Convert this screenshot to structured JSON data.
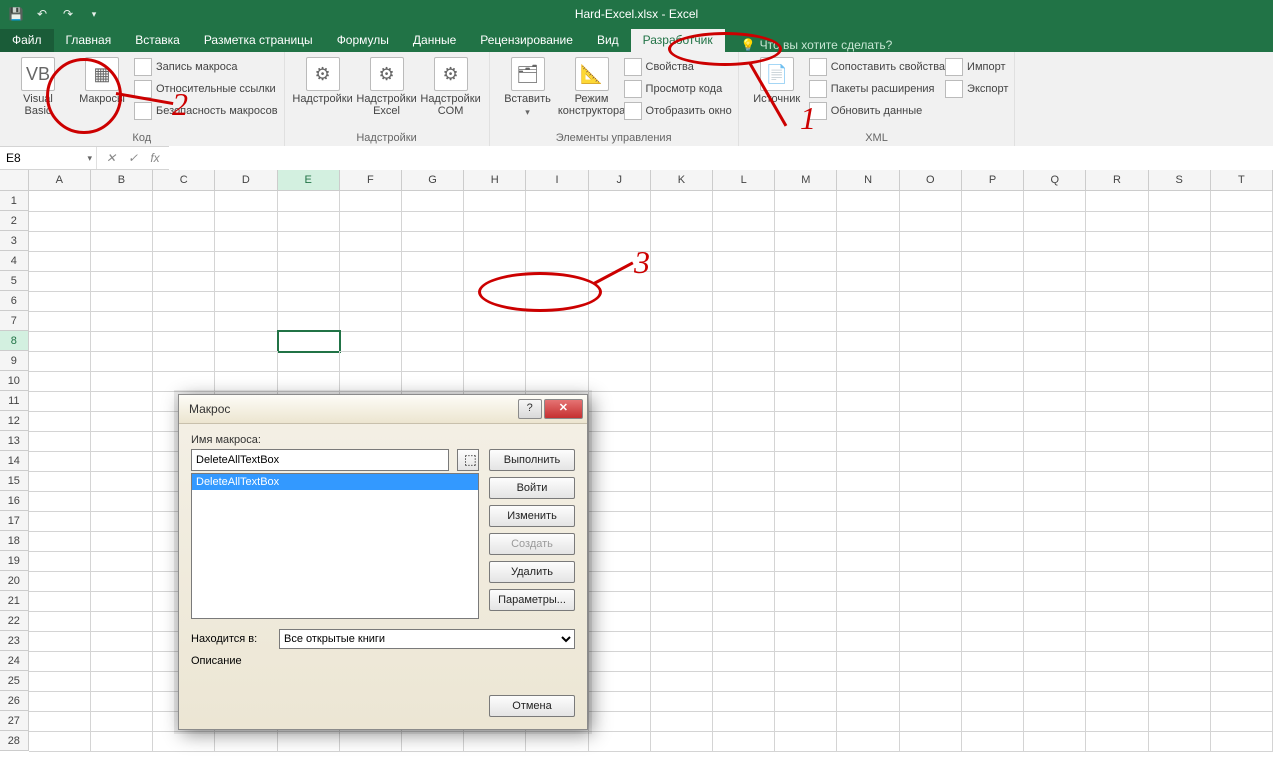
{
  "title": "Hard-Excel.xlsx - Excel",
  "tabs": {
    "file": "Файл",
    "home": "Главная",
    "insert": "Вставка",
    "layout": "Разметка страницы",
    "formulas": "Формулы",
    "data": "Данные",
    "review": "Рецензирование",
    "view": "Вид",
    "developer": "Разработчик",
    "tellme": "Что вы хотите сделать?"
  },
  "ribbon": {
    "code": {
      "vb": "Visual\nBasic",
      "macros": "Макросы",
      "record": "Запись макроса",
      "relative": "Относительные ссылки",
      "security": "Безопасность макросов",
      "group": "Код"
    },
    "addins": {
      "addins": "Надстройки",
      "excel": "Надстройки\nExcel",
      "com": "Надстройки\nCOM",
      "group": "Надстройки"
    },
    "controls": {
      "insert": "Вставить",
      "design": "Режим\nконструктора",
      "props": "Свойства",
      "viewcode": "Просмотр кода",
      "showwin": "Отобразить окно",
      "group": "Элементы управления"
    },
    "xml": {
      "source": "Источник",
      "mapprops": "Сопоставить свойства",
      "expansion": "Пакеты расширения",
      "refresh": "Обновить данные",
      "import": "Импорт",
      "export": "Экспорт",
      "group": "XML"
    }
  },
  "namebox": "E8",
  "columns": [
    "A",
    "B",
    "C",
    "D",
    "E",
    "F",
    "G",
    "H",
    "I",
    "J",
    "K",
    "L",
    "M",
    "N",
    "O",
    "P",
    "Q",
    "R",
    "S",
    "T"
  ],
  "rows": [
    "1",
    "2",
    "3",
    "4",
    "5",
    "6",
    "7",
    "8",
    "9",
    "10",
    "11",
    "12",
    "13",
    "14",
    "15",
    "16",
    "17",
    "18",
    "19",
    "20",
    "21",
    "22",
    "23",
    "24",
    "25",
    "26",
    "27",
    "28"
  ],
  "selected_cell": {
    "col": "E",
    "row": "8"
  },
  "dialog": {
    "title": "Макрос",
    "name_label": "Имя макроса:",
    "name_value": "DeleteAllTextBox",
    "list": [
      "DeleteAllTextBox"
    ],
    "btn_run": "Выполнить",
    "btn_step": "Войти",
    "btn_edit": "Изменить",
    "btn_create": "Создать",
    "btn_delete": "Удалить",
    "btn_options": "Параметры...",
    "in_label": "Находится в:",
    "in_value": "Все открытые книги",
    "desc_label": "Описание",
    "btn_cancel": "Отмена"
  },
  "annotations": {
    "a1": "1",
    "a2": "2",
    "a3": "3"
  }
}
